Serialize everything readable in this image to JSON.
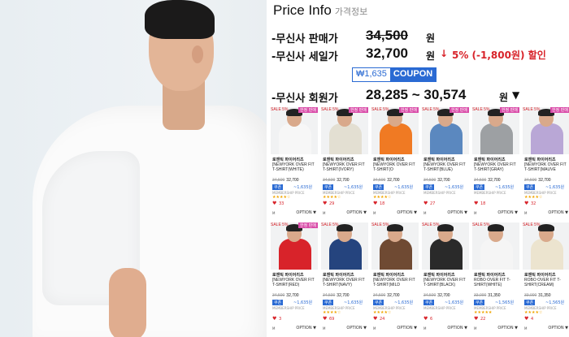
{
  "header": {
    "title": "Price Info",
    "subtitle": "가격정보"
  },
  "prices": {
    "list_label": "-무신사 판매가",
    "list_value": "34,500",
    "sale_label": "-무신사 세일가",
    "sale_value": "32,700",
    "won": "원",
    "discount_arrow": "↓",
    "discount": "5% (-1,800원) 할인",
    "coupon_amount": "₩1,635",
    "coupon_label": "COUPON",
    "member_label": "-무신사 회원가",
    "member_range": "28,285 ~ 30,574",
    "dropdown_glyph": "▼"
  },
  "colors": {
    "accent_red": "#d8232a",
    "coupon_blue": "#2a6ad3",
    "limited_pink": "#d94ba8"
  },
  "products": {
    "row1": [
      {
        "sale": "SALE 5%",
        "limited": "한정 판매",
        "brand": "로맨틱 파이어리츠",
        "name": "[NEWYORK OVER FIT T-SHIRT(WHITE)",
        "orig": "34,500",
        "price": "32,700",
        "coupon": "쿠폰",
        "coupon_val": "~1,635원",
        "member": "MEMBERSHIP PRICE",
        "stars": "★★★★☆",
        "likes": "33",
        "size": "M",
        "option": "OPTION ▼",
        "shirt": "#f7f7f7"
      },
      {
        "sale": "SALE 5%",
        "limited": "한정 판매",
        "brand": "로맨틱 파이어리츠",
        "name": "[NEWYORK OVER FIT T-SHIRT(IVORY)",
        "orig": "34,500",
        "price": "32,700",
        "coupon": "쿠폰",
        "coupon_val": "~1,635원",
        "member": "MEMBERSHIP PRICE",
        "stars": "★★★★☆",
        "likes": "29",
        "size": "M",
        "option": "OPTION ▼",
        "shirt": "#e3dfd2"
      },
      {
        "sale": "SALE 5%",
        "limited": "한정 판매",
        "brand": "로맨틱 파이어리츠",
        "name": "[NEWYORK OVER FIT T-SHIRT(O",
        "orig": "34,500",
        "price": "32,700",
        "coupon": "쿠폰",
        "coupon_val": "~1,635원",
        "member": "MEMBERSHIP PRICE",
        "stars": "★★★★☆",
        "likes": "18",
        "size": "M",
        "option": "OPTION ▼",
        "shirt": "#f07a23"
      },
      {
        "sale": "SALE 5%",
        "limited": "한정 판매",
        "brand": "로맨틱 파이어리츠",
        "name": "[NEWYORK OVER FIT T-SHIRT(BLUE)",
        "orig": "34,500",
        "price": "32,700",
        "coupon": "쿠폰",
        "coupon_val": "~1,635원",
        "member": "MEMBERSHIP PRICE",
        "stars": "",
        "likes": "27",
        "size": "M",
        "option": "OPTION ▼",
        "shirt": "#5b88bf"
      },
      {
        "sale": "SALE 5%",
        "limited": "한정 판매",
        "brand": "로맨틱 파이어리츠",
        "name": "[NEWYORK OVER FIT T-SHIRT(GRAY)",
        "orig": "34,500",
        "price": "32,700",
        "coupon": "쿠폰",
        "coupon_val": "~1,635원",
        "member": "MEMBERSHIP PRICE",
        "stars": "",
        "likes": "18",
        "size": "M",
        "option": "OPTION ▼",
        "shirt": "#9da0a3"
      },
      {
        "sale": "SALE 5%",
        "limited": "한정 판매",
        "brand": "로맨틱 파이어리츠",
        "name": "[NEWYORK OVER FIT T-SHIRT(MAUVE",
        "orig": "34,500",
        "price": "32,700",
        "coupon": "쿠폰",
        "coupon_val": "~1,635원",
        "member": "MEMBERSHIP PRICE",
        "stars": "★★★★☆",
        "likes": "32",
        "size": "M",
        "option": "OPTION ▼",
        "shirt": "#b9a7d6"
      }
    ],
    "row2": [
      {
        "sale": "SALE 5%",
        "limited": "한정 판매",
        "brand": "로맨틱 파이어리츠",
        "name": "[NEWYORK OVER FIT T-SHIRT(RED)",
        "orig": "34,500",
        "price": "32,700",
        "coupon": "쿠폰",
        "coupon_val": "~1,635원",
        "member": "MEMBERSHIP PRICE",
        "stars": "",
        "likes": "3",
        "size": "M",
        "option": "OPTION ▼",
        "shirt": "#d8232a"
      },
      {
        "sale": "SALE 5%",
        "limited": "",
        "brand": "로맨틱 파이어리츠",
        "name": "[NEWYORK OVER FIT T-SHIRT(NAVY)",
        "orig": "34,500",
        "price": "32,700",
        "coupon": "쿠폰",
        "coupon_val": "~1,635원",
        "member": "MEMBERSHIP PRICE",
        "stars": "★★★★☆",
        "likes": "69",
        "size": "M",
        "option": "OPTION ▼",
        "shirt": "#25447e"
      },
      {
        "sale": "SALE 5%",
        "limited": "",
        "brand": "로맨틱 파이어리츠",
        "name": "[NEWYORK OVER FIT T-SHIRT(MILD",
        "orig": "34,500",
        "price": "32,700",
        "coupon": "쿠폰",
        "coupon_val": "~1,635원",
        "member": "MEMBERSHIP PRICE",
        "stars": "★★★★☆",
        "likes": "24",
        "size": "M",
        "option": "OPTION ▼",
        "shirt": "#6f4a33"
      },
      {
        "sale": "SALE 5%",
        "limited": "",
        "brand": "로맨틱 파이어리츠",
        "name": "[NEWYORK OVER FIT T-SHIRT(BLACK)",
        "orig": "34,500",
        "price": "32,700",
        "coupon": "쿠폰",
        "coupon_val": "~1,635원",
        "member": "MEMBERSHIP PRICE",
        "stars": "",
        "likes": "6",
        "size": "M",
        "option": "OPTION ▼",
        "shirt": "#2a2a2a"
      },
      {
        "sale": "SALE 5%",
        "limited": "",
        "brand": "로맨틱 파이어리츠",
        "name": "ROBO OVER FIT T-SHIRT(WHITE)",
        "orig": "33,000",
        "price": "31,350",
        "coupon": "쿠폰",
        "coupon_val": "~1,565원",
        "member": "MEMBERSHIP PRICE",
        "stars": "★★★★★",
        "likes": "22",
        "size": "M",
        "option": "OPTION ▼",
        "shirt": "#f5f5f5"
      },
      {
        "sale": "SALE 5%",
        "limited": "",
        "brand": "로맨틱 파이어리츠",
        "name": "ROBO OVER FIT T-SHIRT(CREAM)",
        "orig": "33,000",
        "price": "31,350",
        "coupon": "쿠폰",
        "coupon_val": "~1,565원",
        "member": "MEMBERSHIP PRICE",
        "stars": "★★★★☆",
        "likes": "4",
        "size": "M",
        "option": "OPTION ▼",
        "shirt": "#ece4cf"
      }
    ]
  }
}
